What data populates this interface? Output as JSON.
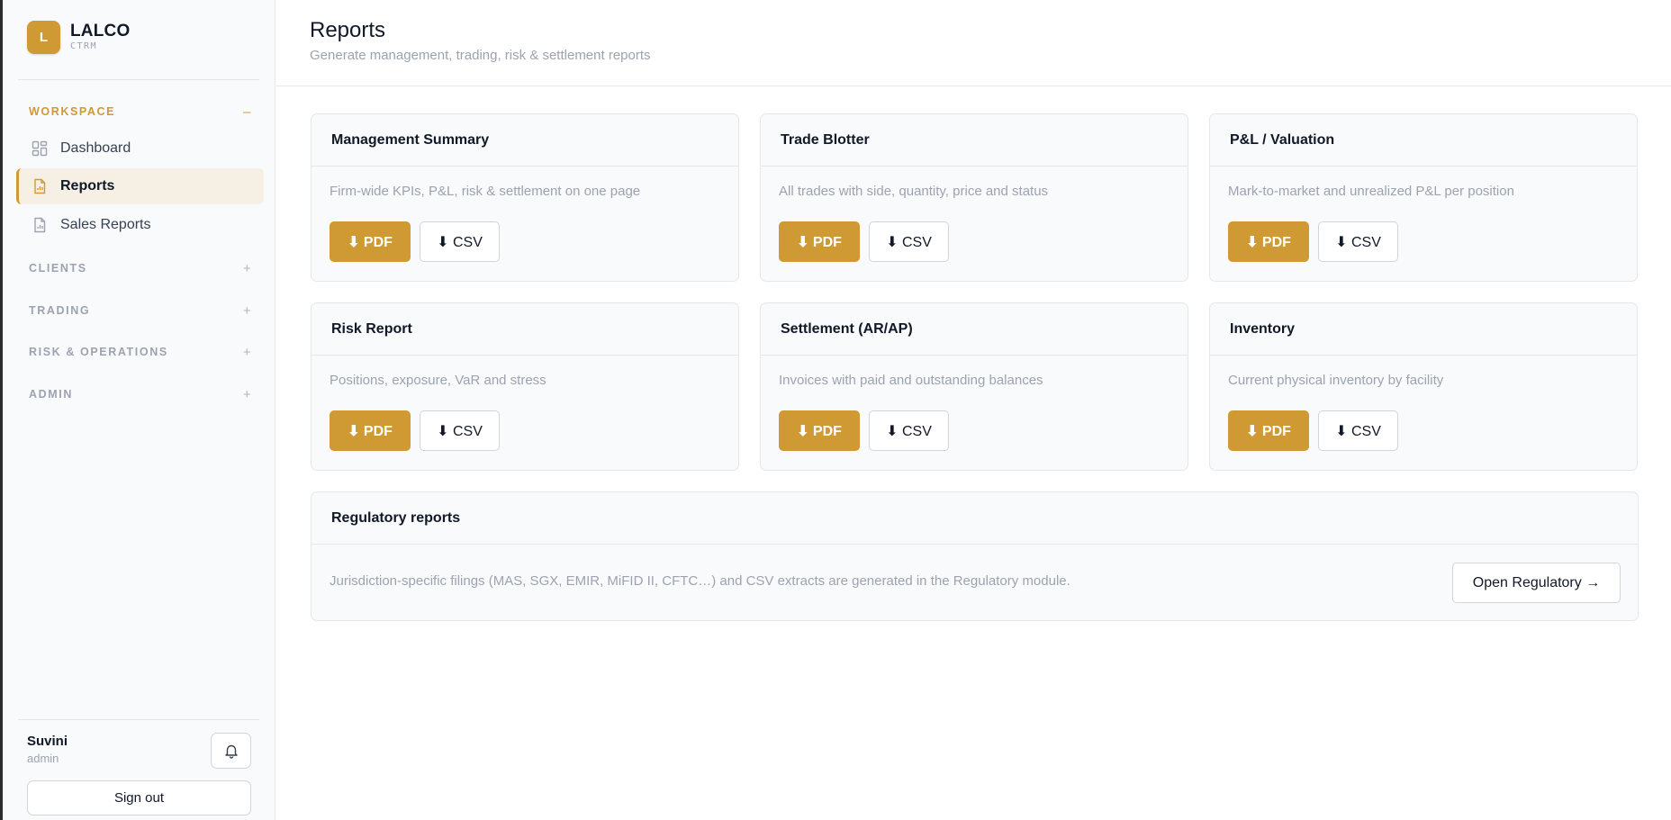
{
  "brand": {
    "logo_letter": "L",
    "name": "LALCO",
    "subtitle": "CTRM",
    "accent_color": "#cf9a34"
  },
  "sidebar": {
    "sections": [
      {
        "label": "WORKSPACE",
        "toggle": "–",
        "expanded": true,
        "items": [
          {
            "label": "Dashboard",
            "icon": "dashboard-icon",
            "active": false
          },
          {
            "label": "Reports",
            "icon": "report-file-icon",
            "active": true
          },
          {
            "label": "Sales Reports",
            "icon": "report-file-icon",
            "active": false
          }
        ]
      },
      {
        "label": "CLIENTS",
        "toggle": "+",
        "expanded": false
      },
      {
        "label": "TRADING",
        "toggle": "+",
        "expanded": false
      },
      {
        "label": "RISK & OPERATIONS",
        "toggle": "+",
        "expanded": false
      },
      {
        "label": "ADMIN",
        "toggle": "+",
        "expanded": false
      }
    ],
    "user": {
      "name": "Suvini",
      "role": "admin"
    },
    "notifications_icon": "bell-icon",
    "sign_out_label": "Sign out"
  },
  "header": {
    "title": "Reports",
    "subtitle": "Generate management, trading, risk & settlement reports"
  },
  "buttons": {
    "pdf_label": "⬇ PDF",
    "csv_label": "⬇ CSV"
  },
  "reports": [
    {
      "title": "Management Summary",
      "description": "Firm-wide KPIs, P&L, risk & settlement on one page"
    },
    {
      "title": "Trade Blotter",
      "description": "All trades with side, quantity, price and status"
    },
    {
      "title": "P&L / Valuation",
      "description": "Mark-to-market and unrealized P&L per position"
    },
    {
      "title": "Risk Report",
      "description": "Positions, exposure, VaR and stress"
    },
    {
      "title": "Settlement (AR/AP)",
      "description": "Invoices with paid and outstanding balances"
    },
    {
      "title": "Inventory",
      "description": "Current physical inventory by facility"
    }
  ],
  "regulatory": {
    "title": "Regulatory reports",
    "description": "Jurisdiction-specific filings (MAS, SGX, EMIR, MiFID II, CFTC…) and CSV extracts are generated in the Regulatory module.",
    "button_label": "Open Regulatory →"
  }
}
